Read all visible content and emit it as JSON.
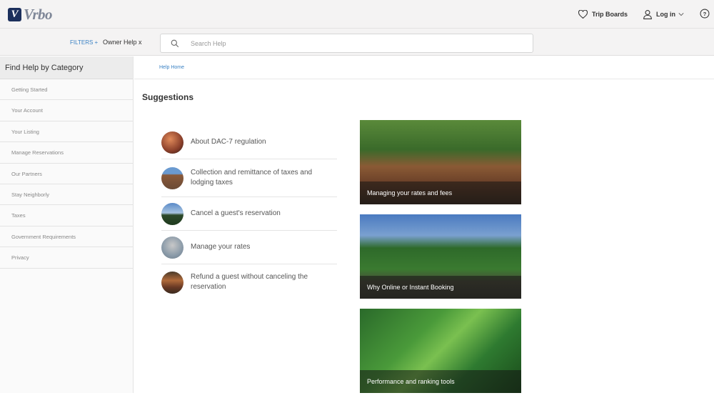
{
  "header": {
    "logo_mark": "V",
    "logo_text": "Vrbo",
    "trip_boards": "Trip Boards",
    "log_in": "Log in",
    "help_icon": "help-circle-icon"
  },
  "filterbar": {
    "filters_label": "FILTERS +",
    "active_filter": "Owner Help x",
    "search_placeholder": "Search Help",
    "search_value": ""
  },
  "sidebar": {
    "title": "Find Help by Category",
    "items": [
      {
        "label": "Getting Started"
      },
      {
        "label": "Your Account"
      },
      {
        "label": "Your Listing"
      },
      {
        "label": "Manage Reservations"
      },
      {
        "label": "Our Partners"
      },
      {
        "label": "Stay Neighborly"
      },
      {
        "label": "Taxes"
      },
      {
        "label": "Government Requirements"
      },
      {
        "label": "Privacy"
      }
    ]
  },
  "main": {
    "breadcrumb": "Help Home",
    "suggestions_title": "Suggestions",
    "suggestions": [
      {
        "label": "About DAC-7 regulation",
        "thumb_color": "#a8553a"
      },
      {
        "label": "Collection and remittance of taxes and lodging taxes",
        "thumb_color": "#7a5a45"
      },
      {
        "label": "Cancel a guest's reservation",
        "thumb_color": "#4a6e8a"
      },
      {
        "label": "Manage your rates",
        "thumb_color": "#9aa3ad"
      },
      {
        "label": "Refund a guest without canceling the reservation",
        "thumb_color": "#6a4a35"
      }
    ],
    "cards": [
      {
        "caption": "Managing your rates and fees"
      },
      {
        "caption": "Why Online or Instant Booking"
      },
      {
        "caption": "Performance and ranking tools"
      }
    ]
  }
}
